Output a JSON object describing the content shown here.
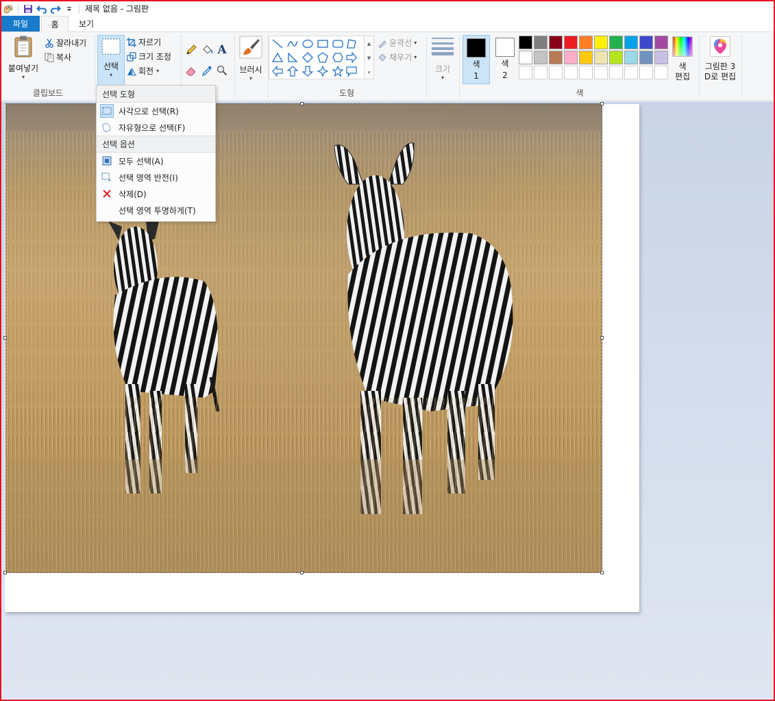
{
  "title_bar": {
    "title": "제목 없음 - 그림판"
  },
  "tabs": {
    "file": "파일",
    "home": "홈",
    "view": "보기"
  },
  "clipboard": {
    "paste": "붙여넣기",
    "cut": "잘라내기",
    "copy": "복사",
    "group": "클립보드"
  },
  "image": {
    "select": "선택",
    "crop": "자르기",
    "resize": "크기 조정",
    "rotate": "회전"
  },
  "brushes": {
    "label": "브러시"
  },
  "shapes": {
    "outline": "윤곽선",
    "fill": "채우기",
    "group": "도형"
  },
  "size": {
    "label": "크기"
  },
  "colors": {
    "color1_label": "색",
    "color1_num": "1",
    "color2_label": "색",
    "color2_num": "2",
    "edit_label": "색",
    "edit_label2": "편집",
    "group": "색",
    "color1_value": "#000000",
    "color2_value": "#ffffff",
    "palette_row1": [
      "#000000",
      "#7f7f7f",
      "#880015",
      "#ed1c24",
      "#ff7f27",
      "#fff200",
      "#22b14c",
      "#00a2e8",
      "#3f48cc",
      "#a349a4"
    ],
    "palette_row2": [
      "#ffffff",
      "#c3c3c3",
      "#b97a57",
      "#ffaec9",
      "#ffc90e",
      "#efe4b0",
      "#b5e61d",
      "#99d9ea",
      "#7092be",
      "#c8bfe7"
    ]
  },
  "paint3d": {
    "line1": "그림판 3",
    "line2": "D로 편집"
  },
  "select_menu": {
    "header_shape": "선택 도형",
    "rect_select": "사각으로 선택(R)",
    "free_select": "자유형으로 선택(F)",
    "header_options": "선택 옵션",
    "select_all": "모두 선택(A)",
    "invert": "선택 영역 반전(I)",
    "delete": "삭제(D)",
    "transparent": "선택 영역 투명하게(T)"
  }
}
